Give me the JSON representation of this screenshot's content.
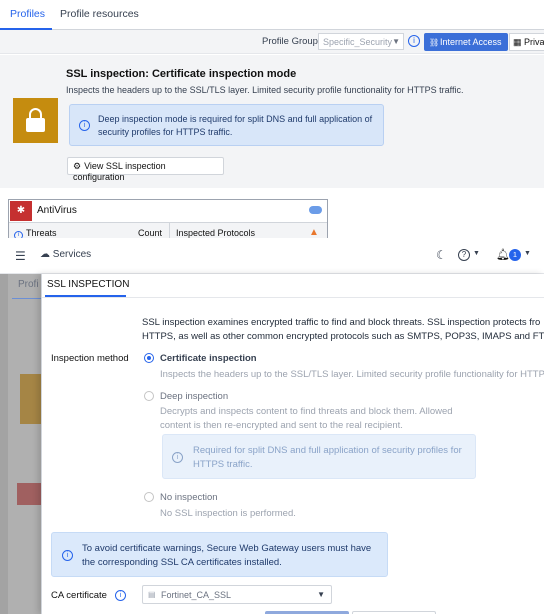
{
  "bg": {
    "tabs": [
      "Profiles",
      "Profile resources"
    ],
    "profile_group_label": "Profile Group:",
    "profile_group_value": "Specific_Security",
    "internet_access_button": "Internet Access",
    "private_button": "Priva",
    "ssl_title": "SSL inspection: Certificate inspection mode",
    "ssl_subtitle": "Inspects the headers up to the SSL/TLS layer. Limited security profile functionality for HTTPS traffic.",
    "deep_notice_line1": "Deep inspection mode is required for split DNS and full application of",
    "deep_notice_line2": "security profiles for HTTPS traffic.",
    "view_config_button": "View SSL inspection configuration",
    "antivirus_title": "AntiVirus",
    "antivirus_columns": [
      "Threats",
      "Count",
      "Inspected Protocols"
    ]
  },
  "topbar": {
    "services_label": "Services",
    "notification_count": "1"
  },
  "ghost_tab": "Profi",
  "panel": {
    "tab_label": "SSL INSPECTION",
    "intro_line1": "SSL inspection examines encrypted traffic to find and block threats. SSL inspection protects fro",
    "intro_line2": "HTTPS, as well as other common encrypted protocols such as SMTPS, POP3S, IMAPS and FTPS",
    "inspection_method_label": "Inspection method",
    "options": [
      {
        "title": "Certificate inspection",
        "desc1": "Inspects the headers up to the SSL/TLS layer. Limited security profile functionality for HTTP",
        "desc2": ""
      },
      {
        "title": "Deep inspection",
        "desc1": "Decrypts and inspects content to find threats and block them. Allowed",
        "desc2": "content is then re-encrypted and sent to the real recipient."
      },
      {
        "title": "No inspection",
        "desc1": "No SSL inspection is performed.",
        "desc2": ""
      }
    ],
    "deep_notice_line1": "Required for split DNS and full application of security profiles for",
    "deep_notice_line2": "HTTPS traffic.",
    "warning_line1": "To avoid certificate warnings, Secure Web Gateway users must have",
    "warning_line2": "the corresponding SSL CA certificates installed.",
    "ca_label": "CA certificate",
    "ca_value": "Fortinet_CA_SSL"
  }
}
